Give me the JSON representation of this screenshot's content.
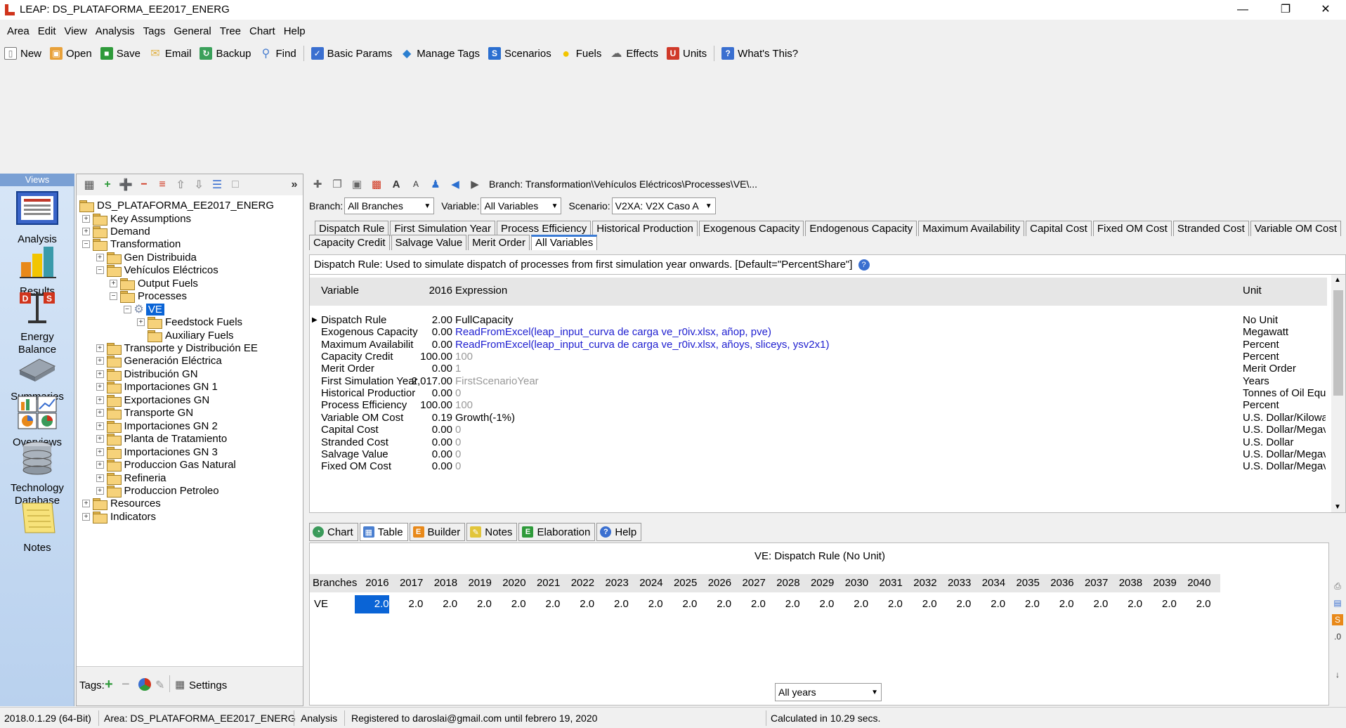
{
  "window": {
    "title": "LEAP: DS_PLATAFORMA_EE2017_ENERG",
    "minimize": "—",
    "maximize": "❐",
    "close": "✕"
  },
  "menu": [
    "Area",
    "Edit",
    "View",
    "Analysis",
    "Tags",
    "General",
    "Tree",
    "Chart",
    "Help"
  ],
  "toolbar": [
    {
      "label": "New",
      "icon": "new-doc-icon",
      "color": "#ffffff"
    },
    {
      "label": "Open",
      "icon": "open-folder-icon",
      "color": "#e8a13a"
    },
    {
      "label": "Save",
      "icon": "save-icon",
      "color": "#2e9a3a"
    },
    {
      "label": "Email",
      "icon": "envelope-icon",
      "color": "#e2b54d"
    },
    {
      "label": "Backup",
      "icon": "backup-icon",
      "color": "#3aa05a"
    },
    {
      "label": "Find",
      "icon": "magnifier-icon",
      "color": "#4a7fd0"
    },
    {
      "label": "Basic Params",
      "icon": "checklist-icon",
      "color": "#3a6fd0"
    },
    {
      "label": "Manage Tags",
      "icon": "tag-icon",
      "color": "#2b7fd0"
    },
    {
      "label": "Scenarios",
      "icon": "scenarios-icon",
      "color": "#2b6fd0"
    },
    {
      "label": "Fuels",
      "icon": "fuel-drop-icon",
      "color": "#f2c500"
    },
    {
      "label": "Effects",
      "icon": "cloud-icon",
      "color": "#666666"
    },
    {
      "label": "Units",
      "icon": "units-icon",
      "color": "#d03a2a"
    },
    {
      "label": "What's This?",
      "icon": "help-pointer-icon",
      "color": "#3a6fd0"
    }
  ],
  "views": {
    "header": "Views",
    "items": [
      {
        "label": "Analysis",
        "icon": "analysis-icon"
      },
      {
        "label": "Results",
        "icon": "results-chart-icon"
      },
      {
        "label": "Energy\nBalance",
        "icon": "energy-balance-icon"
      },
      {
        "label": "Summaries",
        "icon": "summaries-icon"
      },
      {
        "label": "Overviews",
        "icon": "overviews-icon"
      },
      {
        "label": "Technology\nDatabase",
        "icon": "database-icon"
      },
      {
        "label": "Notes",
        "icon": "notes-icon"
      }
    ]
  },
  "tree": {
    "collapse_button": "»",
    "root": "DS_PLATAFORMA_EE2017_ENERG",
    "nodes": [
      {
        "label": "Key Assumptions",
        "level": 1,
        "expander": "+"
      },
      {
        "label": "Demand",
        "level": 1,
        "expander": "+"
      },
      {
        "label": "Transformation",
        "level": 1,
        "expander": "−"
      },
      {
        "label": "Gen Distribuida",
        "level": 2,
        "expander": "+"
      },
      {
        "label": "Vehículos Eléctricos",
        "level": 2,
        "expander": "−"
      },
      {
        "label": "Output Fuels",
        "level": 3,
        "expander": "+"
      },
      {
        "label": "Processes",
        "level": 3,
        "expander": "−"
      },
      {
        "label": "VE",
        "level": 4,
        "expander": "−",
        "selected": true
      },
      {
        "label": "Feedstock Fuels",
        "level": 5,
        "expander": "+"
      },
      {
        "label": "Auxiliary Fuels",
        "level": 5,
        "expander": ""
      },
      {
        "label": "Transporte y Distribución EE",
        "level": 2,
        "expander": "+"
      },
      {
        "label": "Generación Eléctrica",
        "level": 2,
        "expander": "+"
      },
      {
        "label": "Distribución GN",
        "level": 2,
        "expander": "+"
      },
      {
        "label": "Importaciones GN 1",
        "level": 2,
        "expander": "+"
      },
      {
        "label": "Exportaciones GN",
        "level": 2,
        "expander": "+"
      },
      {
        "label": "Transporte GN",
        "level": 2,
        "expander": "+"
      },
      {
        "label": "Importaciones GN 2",
        "level": 2,
        "expander": "+"
      },
      {
        "label": "Planta de Tratamiento",
        "level": 2,
        "expander": "+"
      },
      {
        "label": "Importaciones GN 3",
        "level": 2,
        "expander": "+"
      },
      {
        "label": "Produccion Gas Natural",
        "level": 2,
        "expander": "+"
      },
      {
        "label": "Refineria",
        "level": 2,
        "expander": "+"
      },
      {
        "label": "Produccion Petroleo",
        "level": 2,
        "expander": "+"
      },
      {
        "label": "Resources",
        "level": 1,
        "expander": "+"
      },
      {
        "label": "Indicators",
        "level": 1,
        "expander": "+"
      }
    ]
  },
  "tags": {
    "label": "Tags:",
    "settings": "Settings"
  },
  "branch_path": "Branch: Transformation\\Vehículos Eléctricos\\Processes\\VE\\...",
  "filters": {
    "branch_label": "Branch:",
    "branch_value": "All Branches",
    "variable_label": "Variable:",
    "variable_value": "All Variables",
    "scenario_label": "Scenario:",
    "scenario_value": "V2XA: V2X Caso A"
  },
  "tabs_row1": [
    "Dispatch Rule",
    "First Simulation Year",
    "Process Efficiency",
    "Historical Production",
    "Exogenous Capacity",
    "Endogenous Capacity",
    "Maximum Availability",
    "Capital Cost",
    "Fixed OM Cost",
    "Stranded Cost",
    "Variable OM Cost"
  ],
  "tabs_row2": [
    "Capacity Credit",
    "Salvage Value",
    "Merit Order",
    "All Variables"
  ],
  "active_tab": "All Variables",
  "description": "Dispatch Rule: Used to simulate dispatch of processes from first simulation year onwards. [Default=\"PercentShare\"]",
  "grid": {
    "headers": {
      "variable": "Variable",
      "year": "2016",
      "expression": "Expression",
      "unit": "Unit"
    },
    "rows": [
      {
        "variable": "Dispatch Rule",
        "value": "2.00",
        "expression": "FullCapacity",
        "unit": "No Unit",
        "style": "normal",
        "current": true
      },
      {
        "variable": "Exogenous Capacity",
        "value": "0.00",
        "expression": "ReadFromExcel(leap_input_curva de carga ve_r0iv.xlsx, añop, pve)",
        "unit": "Megawatt",
        "style": "blue"
      },
      {
        "variable": "Maximum Availabilit",
        "value": "0.00",
        "expression": "ReadFromExcel(leap_input_curva de carga ve_r0iv.xlsx, añoys, sliceys, ysv2x1)",
        "unit": "Percent",
        "style": "blue"
      },
      {
        "variable": "Capacity Credit",
        "value": "100.00",
        "expression": "100",
        "unit": "Percent",
        "style": "gray"
      },
      {
        "variable": "Merit Order",
        "value": "0.00",
        "expression": "1",
        "unit": "Merit Order",
        "style": "gray"
      },
      {
        "variable": "First Simulation Year",
        "value": "2,017.00",
        "expression": "FirstScenarioYear",
        "unit": "Years",
        "style": "gray"
      },
      {
        "variable": "Historical Productior",
        "value": "0.00",
        "expression": "0",
        "unit": "Tonnes of Oil Equ",
        "style": "gray"
      },
      {
        "variable": "Process Efficiency",
        "value": "100.00",
        "expression": "100",
        "unit": "Percent",
        "style": "gray"
      },
      {
        "variable": "Variable OM Cost",
        "value": "0.19",
        "expression": "Growth(-1%)",
        "unit": "U.S. Dollar/Kilowa",
        "style": "normal"
      },
      {
        "variable": "Capital Cost",
        "value": "0.00",
        "expression": "0",
        "unit": "U.S. Dollar/Megav",
        "style": "gray"
      },
      {
        "variable": "Stranded Cost",
        "value": "0.00",
        "expression": "0",
        "unit": "U.S. Dollar",
        "style": "gray"
      },
      {
        "variable": "Salvage Value",
        "value": "0.00",
        "expression": "0",
        "unit": "U.S. Dollar/Megav",
        "style": "gray"
      },
      {
        "variable": "Fixed OM Cost",
        "value": "0.00",
        "expression": "0",
        "unit": "U.S. Dollar/Megav",
        "style": "gray"
      }
    ]
  },
  "bottom_tabs": [
    {
      "label": "Chart",
      "icon": "pie-chart-icon",
      "color": "#3a9a5a"
    },
    {
      "label": "Table",
      "icon": "table-grid-icon",
      "color": "#4a7fd0",
      "active": true
    },
    {
      "label": "Builder",
      "icon": "builder-icon",
      "color": "#e8891a"
    },
    {
      "label": "Notes",
      "icon": "note-icon",
      "color": "#e2c53a"
    },
    {
      "label": "Elaboration",
      "icon": "elaboration-icon",
      "color": "#2e9a3a"
    },
    {
      "label": "Help",
      "icon": "help-icon",
      "color": "#3a6fd0"
    }
  ],
  "table": {
    "title": "VE: Dispatch Rule (No Unit)",
    "row_header": "Branches",
    "years": [
      "2016",
      "2017",
      "2018",
      "2019",
      "2020",
      "2021",
      "2022",
      "2023",
      "2024",
      "2025",
      "2026",
      "2027",
      "2028",
      "2029",
      "2030",
      "2031",
      "2032",
      "2033",
      "2034",
      "2035",
      "2036",
      "2037",
      "2038",
      "2039",
      "2040"
    ],
    "rows": [
      {
        "branch": "VE",
        "values": [
          "2.0",
          "2.0",
          "2.0",
          "2.0",
          "2.0",
          "2.0",
          "2.0",
          "2.0",
          "2.0",
          "2.0",
          "2.0",
          "2.0",
          "2.0",
          "2.0",
          "2.0",
          "2.0",
          "2.0",
          "2.0",
          "2.0",
          "2.0",
          "2.0",
          "2.0",
          "2.0",
          "2.0",
          "2.0"
        ]
      }
    ]
  },
  "years_selector": "All years",
  "status": {
    "version": "2018.0.1.29 (64-Bit)",
    "area": "Area: DS_PLATAFORMA_EE2017_ENERG",
    "view": "Analysis",
    "registration": "Registered to daroslai@gmail.com until febrero 19, 2020",
    "calc": "Calculated in 10.29 secs."
  }
}
